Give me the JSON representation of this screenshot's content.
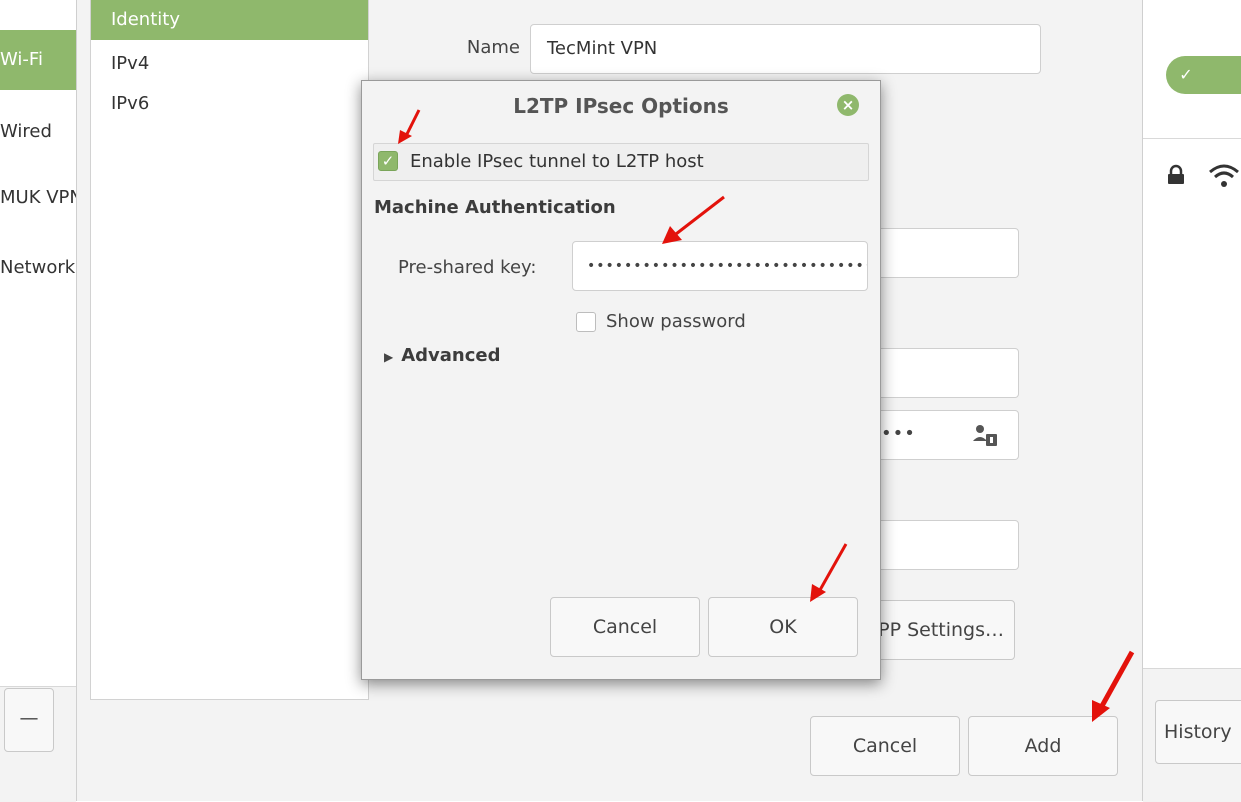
{
  "left_panel": {
    "items": [
      "Wi-Fi",
      "Wired",
      "MUK VPN",
      "Network"
    ],
    "active_index": 0,
    "remove_button": "—"
  },
  "editor": {
    "sidebar": {
      "items": [
        "Identity",
        "IPv4",
        "IPv6"
      ],
      "selected_index": 0
    },
    "name_label": "Name",
    "name_value": "TecMint VPN",
    "password_tail": "•••",
    "ppp_button": "PPP Settings…",
    "cancel_label": "Cancel",
    "add_label": "Add"
  },
  "right_panel": {
    "history_button": "History",
    "toggle_check": "✓"
  },
  "modal": {
    "title": "L2TP IPsec Options",
    "close_glyph": "×",
    "enable_label": "Enable IPsec tunnel to L2TP host",
    "enable_checked": true,
    "section": "Machine Authentication",
    "psk_label": "Pre-shared key:",
    "psk_value": "••••••••••••••••••••••••••••••••",
    "show_password_label": "Show password",
    "show_password_checked": false,
    "advanced_label": "Advanced",
    "cancel_label": "Cancel",
    "ok_label": "OK"
  },
  "colors": {
    "accent": "#8fb86c",
    "annotation_arrow": "#e3120b",
    "dialog_bg": "#f3f3f3"
  },
  "icons": [
    "check-icon",
    "close-icon",
    "triangle-right-icon",
    "lock-icon",
    "wifi-icon",
    "user-key-icon",
    "red-arrow-annotation"
  ]
}
